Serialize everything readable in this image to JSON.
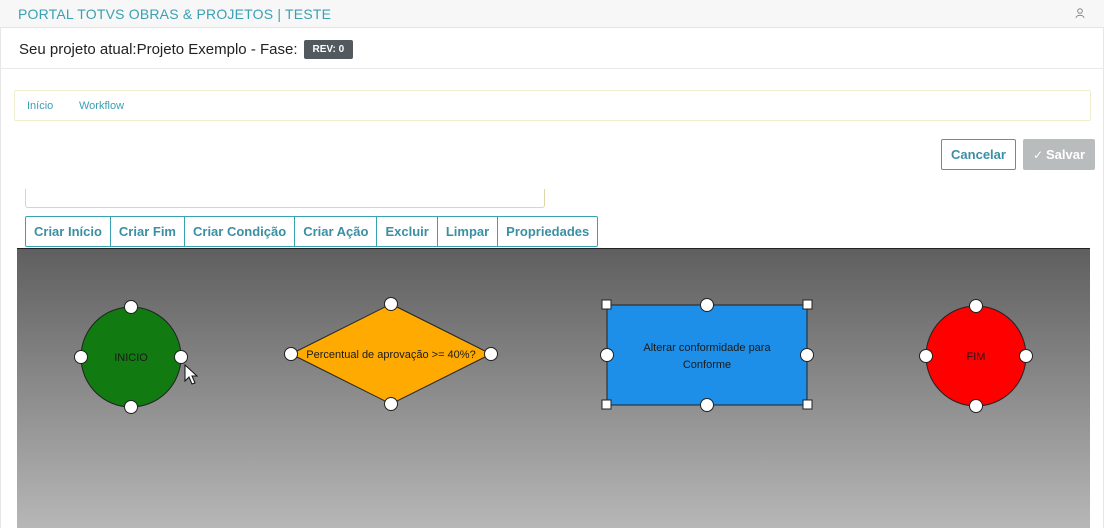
{
  "header": {
    "app_title": "PORTAL TOTVS OBRAS & PROJETOS | TESTE",
    "user_icon": "user-icon"
  },
  "project": {
    "label": "Seu projeto atual:",
    "name": "Projeto Exemplo - Fase:",
    "rev_badge": "REV: 0"
  },
  "breadcrumb": {
    "items": [
      "Início",
      "Workflow"
    ]
  },
  "actions": {
    "cancel_label": "Cancelar",
    "save_label": "Salvar",
    "save_icon": "check-icon"
  },
  "toolbar": {
    "buttons": [
      "Criar Início",
      "Criar Fim",
      "Criar Condição",
      "Criar Ação",
      "Excluir",
      "Limpar",
      "Propriedades"
    ]
  },
  "workflow": {
    "nodes": [
      {
        "type": "start",
        "label": "INICIO",
        "color": "#117a11"
      },
      {
        "type": "condition",
        "label": "Percentual de aprovação >= 40%?",
        "color": "#ffaa00"
      },
      {
        "type": "action",
        "label_line1": "Alterar conformidade para",
        "label_line2": "Conforme",
        "color": "#1e8fe8"
      },
      {
        "type": "end",
        "label": "FIM",
        "color": "#ff0000"
      }
    ]
  },
  "colors": {
    "accent": "#3aa0b3",
    "badge": "#525a5f",
    "save_disabled": "#b9bcbd"
  }
}
